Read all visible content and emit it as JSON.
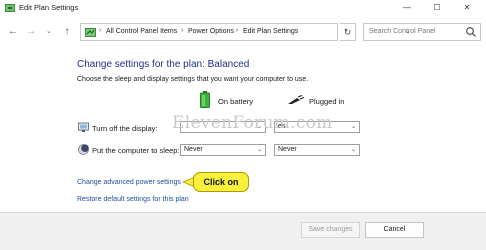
{
  "window": {
    "title": "Edit Plan Settings",
    "min_icon": "minimize-icon",
    "max_icon": "maximize-icon",
    "close_icon": "close-icon"
  },
  "nav": {
    "breadcrumbs": [
      "All Control Panel Items",
      "Power Options",
      "Edit Plan Settings"
    ],
    "separator": "›",
    "search_placeholder": "Search Control Panel"
  },
  "main": {
    "heading": "Change settings for the plan: Balanced",
    "subtext": "Choose the sleep and display settings that you want your computer to use.",
    "columns": {
      "battery": "On battery",
      "plugged": "Plugged in"
    },
    "rows": [
      {
        "label": "Turn off the display:",
        "battery_value": "",
        "plugged_value": "es"
      },
      {
        "label": "Put the computer to sleep:",
        "battery_value": "Never",
        "plugged_value": "Never"
      }
    ],
    "links": {
      "advanced": "Change advanced power settings",
      "restore": "Restore default settings for this plan"
    },
    "watermark": "ElevenForum.com",
    "callout": "Click on"
  },
  "footer": {
    "save": "Save changes",
    "cancel": "Cancel"
  },
  "colors": {
    "heading": "#1e3287",
    "link": "#1e50a0",
    "callout": "#f8f03c"
  }
}
